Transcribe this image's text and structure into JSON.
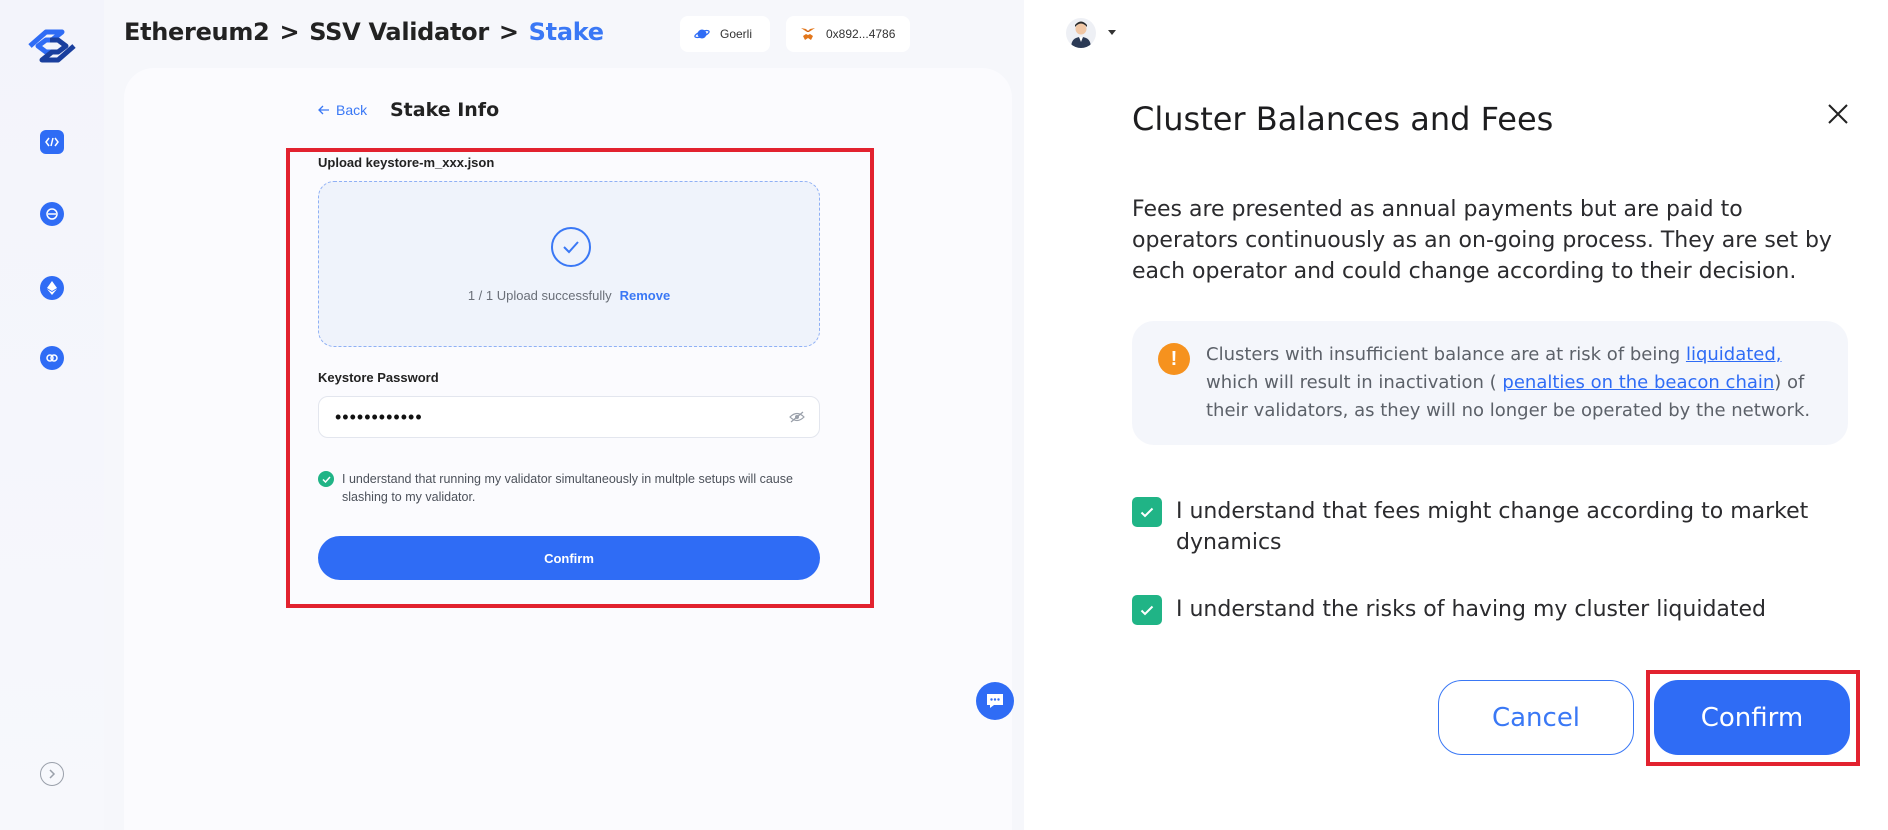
{
  "header": {
    "breadcrumb": [
      "Ethereum2",
      ">",
      "SSV Validator",
      ">",
      "Stake"
    ],
    "network_label": "Goerli",
    "wallet_address": "0x892...4786"
  },
  "stake_form": {
    "back_label": "Back",
    "title": "Stake Info",
    "upload_label": "Upload keystore-m_xxx.json",
    "upload_status": "1 / 1 Upload successfully",
    "remove_label": "Remove",
    "password_label": "Keystore Password",
    "password_value": "••••••••••••",
    "agreement_text": "I understand that running my validator simultaneously in multple setups will cause slashing to my validator.",
    "confirm_label": "Confirm"
  },
  "modal": {
    "title": "Cluster Balances and Fees",
    "description": "Fees are presented as annual payments but are paid to operators continuously as an on-going process. They are set by each operator and could change according to their decision.",
    "warning": {
      "text_before_link1": "Clusters with insufficient balance are at risk of being ",
      "link1": "liquidated,",
      "text_between": " which will result in inactivation ( ",
      "link2": "penalties on the beacon chain",
      "text_after": ") of their validators, as they will no longer be operated by the network."
    },
    "checks": [
      "I understand that fees might change according to market dynamics",
      "I understand the risks of having my cluster liquidated"
    ],
    "cancel_label": "Cancel",
    "confirm_label": "Confirm"
  },
  "colors": {
    "primary": "#2f6cf5",
    "success": "#20b486",
    "warning": "#f6921e",
    "highlight": "#e2222f"
  },
  "icons": [
    "logo-icon",
    "code-icon",
    "ssv-icon",
    "ethereum-icon",
    "link-icon",
    "chevron-right-icon",
    "planet-icon",
    "metamask-icon",
    "avatar",
    "check-icon",
    "eye-off-icon",
    "chat-icon",
    "close-icon",
    "exclamation-icon"
  ]
}
